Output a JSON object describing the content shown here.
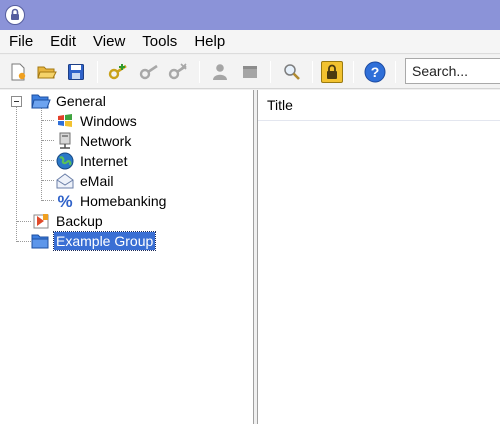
{
  "menu": {
    "file": "File",
    "edit": "Edit",
    "view": "View",
    "tools": "Tools",
    "help": "Help"
  },
  "toolbar": {
    "buttons": [
      "new-database-icon",
      "open-database-icon",
      "save-database-icon",
      "add-entry-icon",
      "edit-entry-icon",
      "delete-entry-icon",
      "copy-username-icon",
      "copy-password-icon",
      "find-icon",
      "lock-workspace-icon",
      "help-icon"
    ],
    "search_placeholder": "Search..."
  },
  "tree": {
    "root": {
      "label": "General",
      "icon": "folder-open-icon",
      "expanded": true
    },
    "children": [
      {
        "label": "Windows",
        "icon": "windows-icon"
      },
      {
        "label": "Network",
        "icon": "network-icon"
      },
      {
        "label": "Internet",
        "icon": "globe-icon"
      },
      {
        "label": "eMail",
        "icon": "email-icon"
      },
      {
        "label": "Homebanking",
        "icon": "percent-icon"
      }
    ],
    "siblings": [
      {
        "label": "Backup",
        "icon": "backup-icon",
        "selected": false
      },
      {
        "label": "Example Group",
        "icon": "folder-icon",
        "selected": true
      }
    ]
  },
  "entry_list": {
    "columns": [
      "Title"
    ]
  },
  "colors": {
    "titlebar": "#8b93d8",
    "selection": "#3a6fd4"
  }
}
